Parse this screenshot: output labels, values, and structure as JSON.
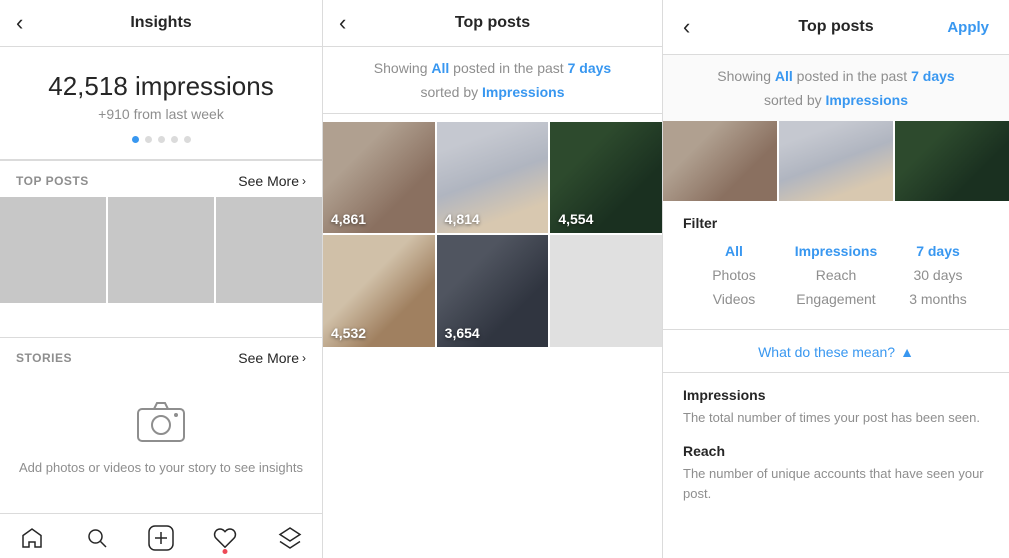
{
  "panel1": {
    "header": {
      "title": "Insights",
      "back_label": "‹"
    },
    "impressions": {
      "number": "42,518 impressions",
      "delta": "+910 from last week"
    },
    "dots": [
      true,
      false,
      false,
      false,
      false
    ],
    "top_posts": {
      "label": "TOP POSTS",
      "see_more": "See More"
    },
    "stories": {
      "label": "STORIES",
      "see_more": "See More",
      "empty_text": "Add photos or videos to your story to\nsee insights"
    },
    "nav_items": [
      "home",
      "search",
      "add",
      "heart",
      "layers"
    ]
  },
  "panel2": {
    "header": {
      "title": "Top posts",
      "back_label": "‹"
    },
    "showing": {
      "prefix": "Showing ",
      "all": "All",
      "middle": " posted in the past ",
      "days": "7 days",
      "sorted_by": "sorted by ",
      "metric": "Impressions"
    },
    "posts": [
      {
        "count": "4,861",
        "color": "#8a9090"
      },
      {
        "count": "4,814",
        "color": "#c0b8a8"
      },
      {
        "count": "4,554",
        "color": "#2d4a2d"
      },
      {
        "count": "4,532",
        "color": "#c0aa88"
      },
      {
        "count": "3,654",
        "color": "#484c58"
      },
      {
        "count": "",
        "color": "#cccccc"
      }
    ]
  },
  "panel3": {
    "header": {
      "title": "Top posts",
      "back_label": "‹",
      "apply_label": "Apply"
    },
    "showing": {
      "prefix": "Showing ",
      "all": "All",
      "middle": " posted in the past ",
      "days": "7 days",
      "sorted_by": "sorted by ",
      "metric": "Impressions"
    },
    "filter": {
      "label": "Filter",
      "rows": [
        [
          {
            "text": "All",
            "state": "active"
          },
          {
            "text": "Impressions",
            "state": "active"
          },
          {
            "text": "7 days",
            "state": "active"
          }
        ],
        [
          {
            "text": "Photos",
            "state": "muted"
          },
          {
            "text": "Reach",
            "state": "muted"
          },
          {
            "text": "30 days",
            "state": "muted"
          }
        ],
        [
          {
            "text": "Videos",
            "state": "muted"
          },
          {
            "text": "Engagement",
            "state": "muted"
          },
          {
            "text": "3 months",
            "state": "muted"
          }
        ]
      ]
    },
    "what_mean": "What do these mean?",
    "definitions": [
      {
        "title": "Impressions",
        "text": "The total number of times your post has been seen."
      },
      {
        "title": "Reach",
        "text": "The number of unique accounts that have seen your post."
      }
    ]
  }
}
